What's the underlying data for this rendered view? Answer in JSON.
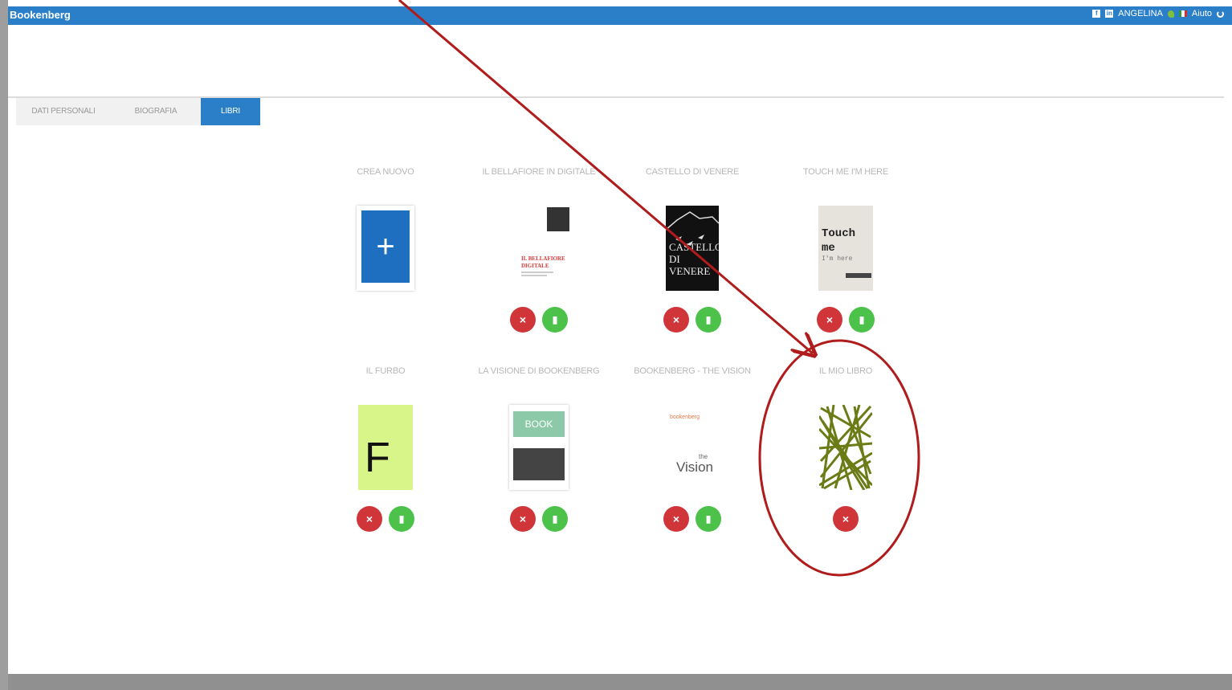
{
  "app": {
    "title": "Bookenberg"
  },
  "topbar": {
    "facebook_icon": "f",
    "linkedin_icon": "in",
    "user": "ANGELINA",
    "help": "Aiuto"
  },
  "tabs": [
    {
      "label": "DATI PERSONALI"
    },
    {
      "label": "BIOGRAFIA"
    },
    {
      "label": "LIBRI",
      "active": true
    }
  ],
  "books": [
    {
      "title": "CREA NUOVO",
      "cover": "new",
      "actions": []
    },
    {
      "title": "IL BELLAFIORE IN DIGITALE",
      "cover": "bellafiore",
      "cover_lines": [
        "IL BELLAFIORE",
        "DIGITALE"
      ],
      "actions": [
        "delete",
        "edit"
      ]
    },
    {
      "title": "CASTELLO DI VENERE",
      "cover": "castello",
      "cover_lines": [
        "CASTELLO",
        "DI",
        "VENERE"
      ],
      "actions": [
        "delete",
        "edit"
      ]
    },
    {
      "title": "TOUCH ME I'M HERE",
      "cover": "touch",
      "cover_lines": [
        "Touch",
        "me",
        "I'm here"
      ],
      "actions": [
        "delete",
        "edit"
      ]
    },
    {
      "title": "IL FURBO",
      "cover": "furbo",
      "cover_lines": [
        "F"
      ],
      "actions": [
        "delete",
        "edit"
      ]
    },
    {
      "title": "LA VISIONE DI BOOKENBERG",
      "cover": "visione",
      "cover_lines": [
        "BOOK"
      ],
      "actions": [
        "delete",
        "edit"
      ]
    },
    {
      "title": "BOOKENBERG - THE VISION",
      "cover": "thevision",
      "cover_lines": [
        "bookenberg",
        "the",
        "Vision"
      ],
      "actions": [
        "delete",
        "edit"
      ]
    },
    {
      "title": "IL MIO LIBRO",
      "cover": "miolibro",
      "actions": [
        "delete"
      ]
    }
  ],
  "colors": {
    "accent": "#2a7fc8",
    "delete": "#d0353a",
    "edit": "#4cc24a",
    "annotation": "#b01c1c"
  }
}
